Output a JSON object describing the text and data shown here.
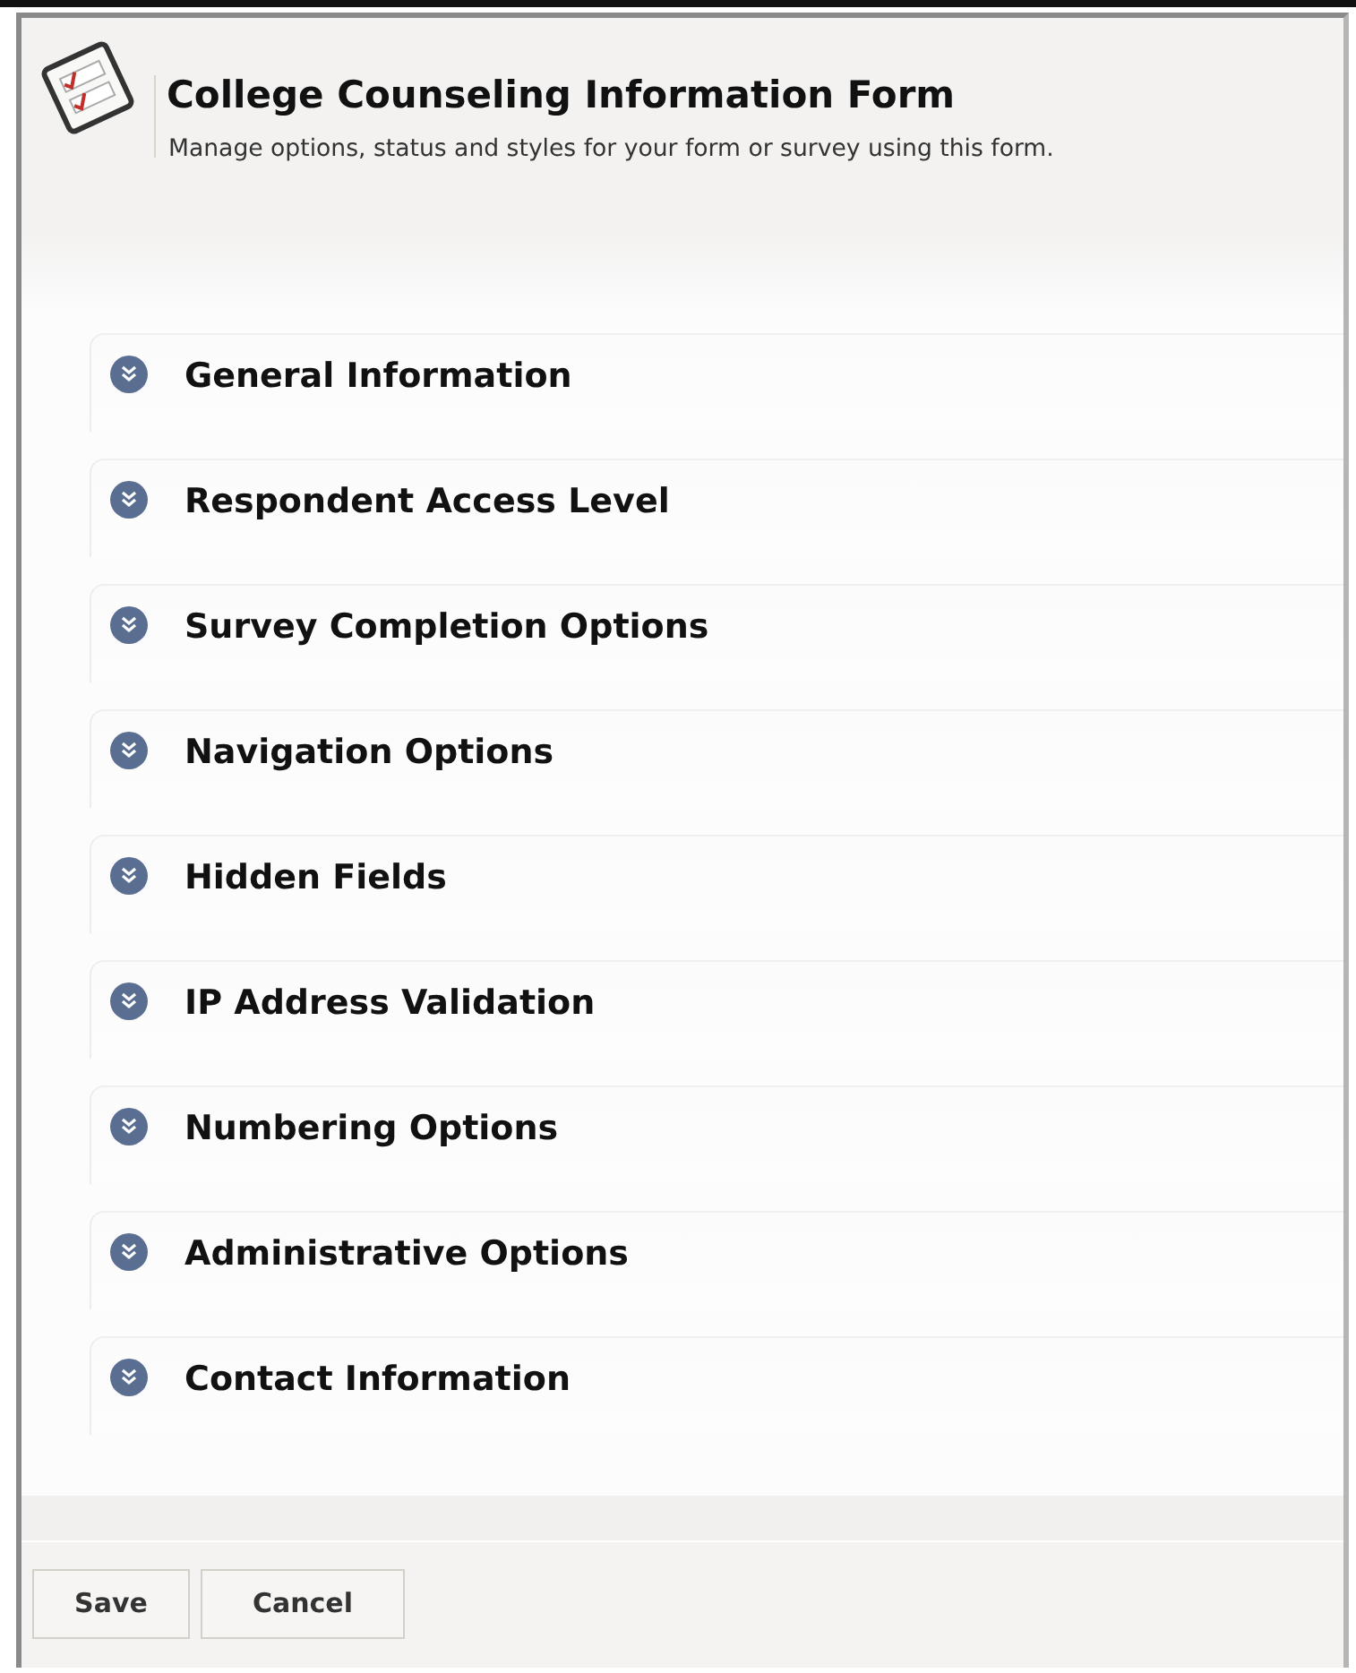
{
  "header": {
    "title": "College Counseling Information Form",
    "subtitle": "Manage options, status and styles for your form or survey using this form."
  },
  "sections": [
    {
      "title": "General Information"
    },
    {
      "title": "Respondent Access Level"
    },
    {
      "title": "Survey Completion Options"
    },
    {
      "title": "Navigation Options"
    },
    {
      "title": "Hidden Fields"
    },
    {
      "title": "IP Address Validation"
    },
    {
      "title": "Numbering Options"
    },
    {
      "title": "Administrative Options"
    },
    {
      "title": "Contact Information"
    }
  ],
  "buttons": [
    "Save",
    "Cancel"
  ]
}
